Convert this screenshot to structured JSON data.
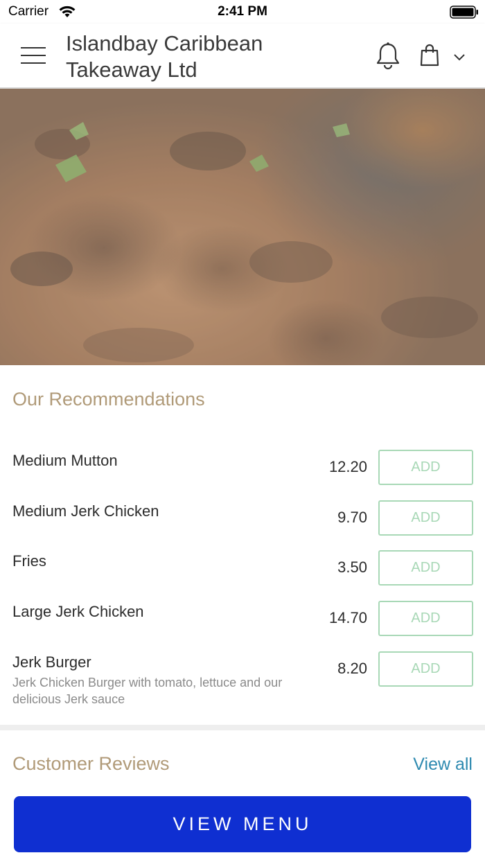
{
  "status_bar": {
    "carrier": "Carrier",
    "time": "2:41 PM"
  },
  "header": {
    "title": "Islandbay Caribbean Takeaway Ltd",
    "icons": [
      "menu-icon",
      "bell-icon",
      "bag-icon",
      "chevron-down-icon"
    ]
  },
  "recommendations": {
    "title": "Our Recommendations",
    "items": [
      {
        "name": "Medium Mutton",
        "description": "",
        "price": "12.20",
        "button": "ADD"
      },
      {
        "name": "Medium Jerk Chicken",
        "description": "",
        "price": "9.70",
        "button": "ADD"
      },
      {
        "name": "Fries",
        "description": "",
        "price": "3.50",
        "button": "ADD"
      },
      {
        "name": "Large Jerk Chicken",
        "description": "",
        "price": "14.70",
        "button": "ADD"
      },
      {
        "name": "Jerk Burger",
        "description": "Jerk Chicken Burger with tomato, lettuce and our delicious Jerk sauce",
        "price": "8.20",
        "button": "ADD"
      }
    ]
  },
  "reviews": {
    "title": "Customer Reviews",
    "view_all": "View all"
  },
  "cta": {
    "label": "VIEW MENU"
  },
  "colors": {
    "section_title": "#b09a78",
    "add_button": "#a8d8b6",
    "link": "#2e8ab0",
    "primary_button": "#0f2fd1"
  }
}
